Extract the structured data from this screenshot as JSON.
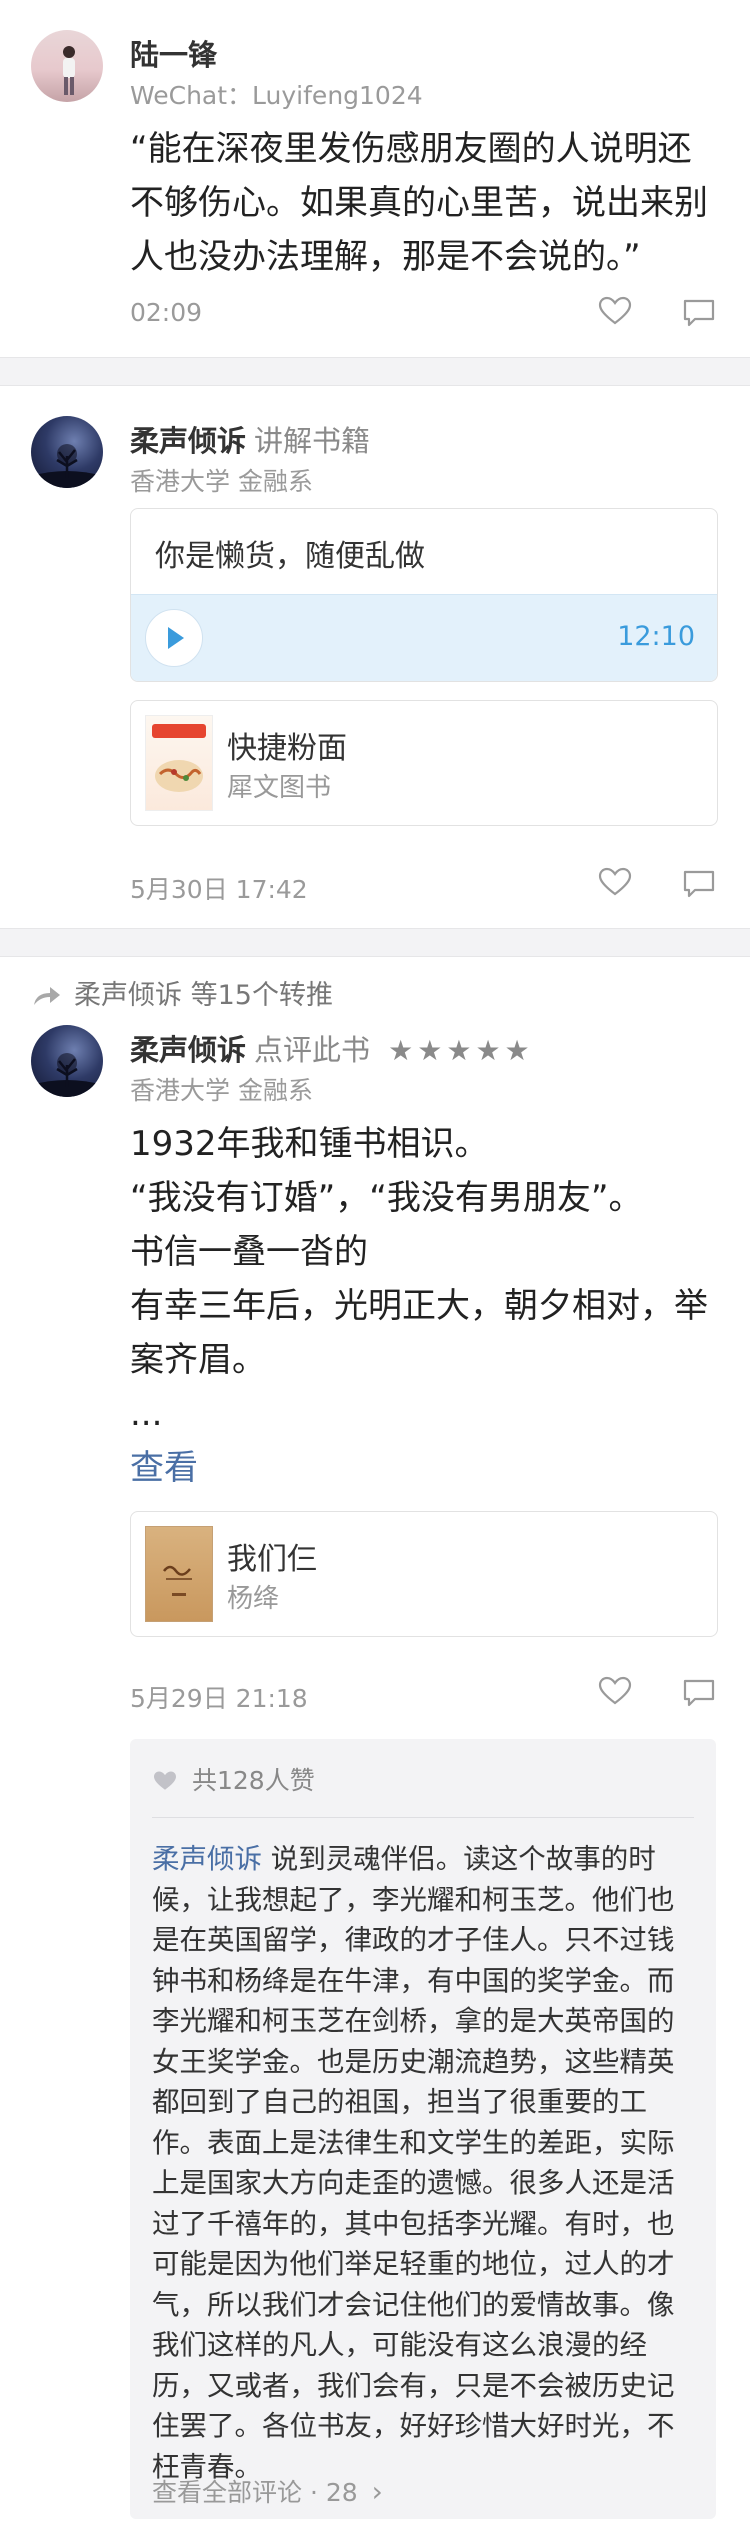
{
  "post1": {
    "author": "陆一锋",
    "wechat": "WeChat：Luyifeng1024",
    "lines": [
      "“能在深夜里发伤感朋友圈的人说明还",
      "不够伤心。如果真的心里苦，说出来别",
      "人也没办法理解，那是不会说的。”"
    ],
    "time": "02:09"
  },
  "post2": {
    "author": "柔声倾诉",
    "tag": "讲解书籍",
    "school": "香港大学 金融系",
    "voice_text": "你是懒货，随便乱做",
    "voice_duration": "12:10",
    "book_title": "快捷粉面",
    "book_author": "犀文图书",
    "time": "5月30日 17:42"
  },
  "post3": {
    "repost_user": "柔声倾诉",
    "repost_count": "等15个转推",
    "author": "柔声倾诉",
    "tag": "点评此书",
    "rating": 5,
    "stars": "★★★★★",
    "school": "香港大学 金融系",
    "lines": [
      "1932年我和锺书相识。",
      "“我没有订婚”，“我没有男朋友”。",
      "书信一叠一沓的",
      "有幸三年后，光明正大，朝夕相对，举",
      "案齐眉。",
      "..."
    ],
    "view_more": "查看",
    "book_title": "我们仨",
    "book_author": "杨绛",
    "time": "5月29日 21:18",
    "likes_label": "共128人赞",
    "comment": {
      "author": "柔声倾诉",
      "lines": [
        " 说到灵魂伴侣。读这个故事的时",
        "候，让我想起了，李光耀和柯玉芝。他们也",
        "是在英国留学，律政的才子佳人。只不过钱",
        "钟书和杨绛是在牛津，有中国的奖学金。而",
        "李光耀和柯玉芝在剑桥，拿的是大英帝国的",
        "女王奖学金。也是历史潮流趋势，这些精英",
        "都回到了自己的祖国，担当了很重要的工",
        "作。表面上是法律生和文学生的差距，实际",
        "上是国家大方向走歪的遗憾。很多人还是活",
        "过了千禧年的，其中包括李光耀。有时，也",
        "可能是因为他们举足轻重的地位，过人的才",
        "气，所以我们才会记住他们的爱情故事。像",
        "我们这样的凡人，可能没有这么浪漫的经",
        "历，又或者，我们会有，只是不会被历史记",
        "住罢了。各位书友，好好珍惜大好时光，不",
        "枉青春。"
      ]
    },
    "all_comments": "查看全部评论 · 28",
    "chevron": "›"
  },
  "colors": {
    "accent": "#4a6fa5",
    "voice_bg": "#e3f1fb",
    "voice_text": "#3a9bdc",
    "gap": "#f3f3f5"
  }
}
